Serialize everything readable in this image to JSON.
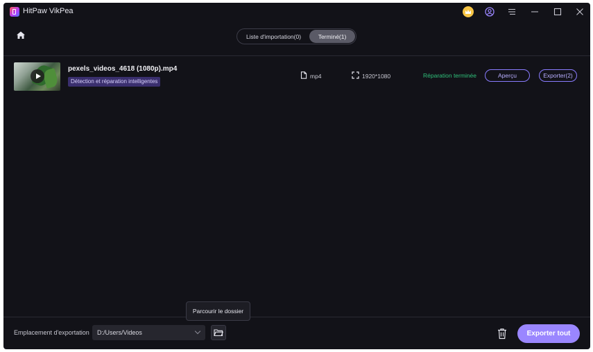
{
  "titlebar": {
    "app_title": "HitPaw VikPea",
    "icons": [
      "crown-icon",
      "user-icon",
      "menu-icon",
      "minimize-icon",
      "maximize-icon",
      "close-icon"
    ]
  },
  "nav": {
    "home_icon": "home-icon",
    "tabs": [
      {
        "label": "Liste d'importation(0)",
        "active": false
      },
      {
        "label": "Terminé(1)",
        "active": true
      }
    ]
  },
  "files": [
    {
      "name": "pexels_videos_4618 (1080p).mp4",
      "tag": "Détection et réparation intelligentes",
      "format": "mp4",
      "resolution": "1920*1080",
      "status": "Réparation terminée",
      "preview_label": "Aperçu",
      "export_label": "Exporter(2)"
    }
  ],
  "footer": {
    "export_location_label": "Emplacement d'exportation",
    "path_value": "D:/Users/Videos",
    "browse_tooltip": "Parcourir le dossier",
    "export_all_label": "Exporter tout"
  },
  "colors": {
    "accent": "#9a86ff",
    "status_green": "#2fc07a",
    "background": "#121218"
  }
}
